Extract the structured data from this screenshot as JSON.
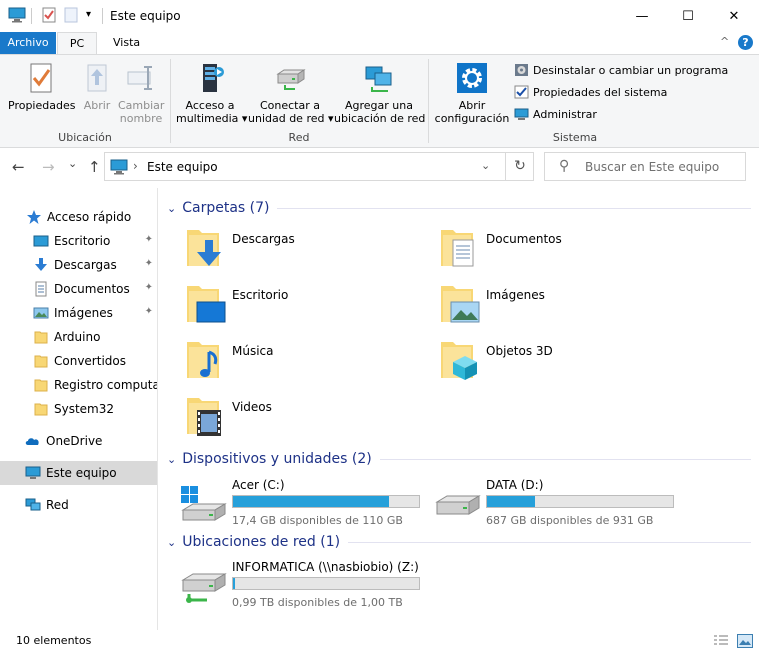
{
  "window": {
    "title": "Este equipo",
    "minimize_glyph": "—",
    "maximize_glyph": "☐",
    "close_glyph": "✕"
  },
  "tabs": {
    "file": "Archivo",
    "pc": "PC",
    "view": "Vista",
    "collapse_glyph": "^",
    "help_glyph": "?"
  },
  "ribbon": {
    "location_group": {
      "label": "Ubicación",
      "properties": "Propiedades",
      "open": "Abrir",
      "rename_line1": "Cambiar",
      "rename_line2": "nombre"
    },
    "network_group": {
      "label": "Red",
      "media_line1": "Acceso a",
      "media_line2": "multimedia",
      "map_line1": "Conectar a",
      "map_line2": "unidad de red",
      "add_line1": "Agregar una",
      "add_line2": "ubicación de red"
    },
    "system_group": {
      "label": "Sistema",
      "open_settings_line1": "Abrir",
      "open_settings_line2": "configuración",
      "uninstall": "Desinstalar o cambiar un programa",
      "system_properties": "Propiedades del sistema",
      "manage": "Administrar"
    },
    "dropdown_glyph": "▾"
  },
  "navigation": {
    "back_glyph": "←",
    "forward_glyph": "→",
    "recent_glyph": "⌄",
    "up_glyph": "↑",
    "address_chevron": "›",
    "address_dropdown": "⌄",
    "refresh_glyph": "↻",
    "address": "Este equipo",
    "search_placeholder": "Buscar en Este equipo",
    "search_glyph": "⚲"
  },
  "sidebar": {
    "quick_access": "Acceso rápido",
    "pin_glyph": "📌",
    "items": [
      {
        "label": "Escritorio",
        "pinned": true
      },
      {
        "label": "Descargas",
        "pinned": true
      },
      {
        "label": "Documentos",
        "pinned": true
      },
      {
        "label": "Imágenes",
        "pinned": true
      },
      {
        "label": "Arduino",
        "pinned": false
      },
      {
        "label": "Convertidos",
        "pinned": false
      },
      {
        "label": "Registro computaci",
        "pinned": false
      },
      {
        "label": "System32",
        "pinned": false
      }
    ],
    "onedrive": "OneDrive",
    "this_pc": "Este equipo",
    "network": "Red"
  },
  "content": {
    "collapse_glyph": "⌄",
    "folders_header": "Carpetas (7)",
    "folders": [
      {
        "name": "Descargas",
        "icon": "download-arrow"
      },
      {
        "name": "Documentos",
        "icon": "document-page"
      },
      {
        "name": "Escritorio",
        "icon": "desktop-screen"
      },
      {
        "name": "Imágenes",
        "icon": "landscape-picture"
      },
      {
        "name": "Música",
        "icon": "music-note"
      },
      {
        "name": "Objetos 3D",
        "icon": "3d-cube"
      },
      {
        "name": "Videos",
        "icon": "film-strip"
      }
    ],
    "devices_header": "Dispositivos y unidades (2)",
    "drives": [
      {
        "name": "Acer (C:)",
        "free": "17,4 GB disponibles de 110 GB",
        "used_fraction": 0.84,
        "icon": "windows-drive"
      },
      {
        "name": "DATA (D:)",
        "free": "687 GB disponibles de 931 GB",
        "used_fraction": 0.26,
        "icon": "hard-drive"
      }
    ],
    "network_header": "Ubicaciones de red (1)",
    "network_drives": [
      {
        "name": "INFORMATICA (\\\\nasbiobio) (Z:)",
        "free": "0,99 TB disponibles de 1,00 TB",
        "used_fraction": 0.01,
        "icon": "network-drive"
      }
    ]
  },
  "colors": {
    "accent": "#1979ca",
    "header_text": "#1e3287",
    "drive_fill": "#26a0da",
    "folder_yellow": "#f8d775"
  },
  "status": {
    "item_count": "10 elementos"
  }
}
